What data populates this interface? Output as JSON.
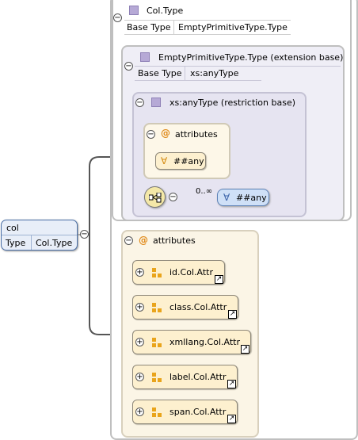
{
  "root": {
    "name": "col",
    "type_label": "Type",
    "type_value": "Col.Type"
  },
  "complex_type": {
    "name": "Col.Type",
    "base_label": "Base Type",
    "base_value": "EmptyPrimitiveType.Type"
  },
  "extension": {
    "name": "EmptyPrimitiveType.Type (extension base)",
    "base_label": "Base Type",
    "base_value": "xs:anyType"
  },
  "restriction": {
    "name": "xs:anyType (restriction base)"
  },
  "inner_attributes": {
    "title": "attributes",
    "any_attr": "##any"
  },
  "sequence": {
    "cardinality": "0..∞",
    "any_element": "##any"
  },
  "attributes": {
    "title": "attributes",
    "items": [
      {
        "label": "id.Col.Attr"
      },
      {
        "label": "class.Col.Attr"
      },
      {
        "label": "xmllang.Col.Attr"
      },
      {
        "label": "label.Col.Attr"
      },
      {
        "label": "span.Col.Attr"
      }
    ]
  },
  "icons": {
    "collapse": "minus-circle-icon",
    "expand": "plus-circle-icon",
    "attribute": "at-sign-icon",
    "type": "purple-square-icon",
    "group": "attribute-group-icon",
    "link": "link-arrow-icon",
    "wildcard": "forall-icon",
    "sequence": "sequence-icon"
  },
  "colors": {
    "type_icon": "#b6a9d6",
    "attribute_icon": "#e08a1a",
    "attr_pill": "#fdf0cf",
    "root_bg": "#d9e4f4",
    "any_bg": "#cfe0f7"
  }
}
